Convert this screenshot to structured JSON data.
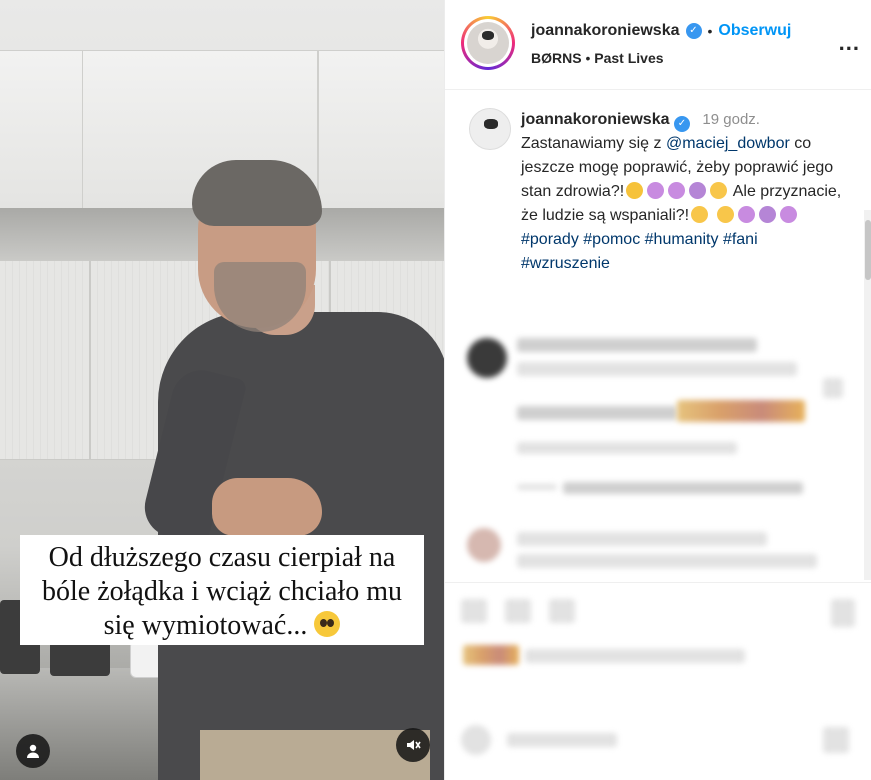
{
  "media": {
    "caption_text": "Od dłuższego czasu cierpiał na bóle żołądka i wciąż chciało mu się wymiotować...",
    "caption_emoji": "pleading-face-emoji",
    "buttons": {
      "profile_tag_icon": "person-icon",
      "mute_icon": "speaker-muted-icon"
    }
  },
  "header": {
    "username": "joannakoroniewska",
    "verified": true,
    "separator": "•",
    "follow_label": "Obserwuj",
    "music_artist": "BØRNS",
    "music_separator": "•",
    "music_track": "Past Lives",
    "more_label": "..."
  },
  "caption": {
    "username": "joannakoroniewska",
    "time": "19 godz.",
    "text_1": "Zastanawiamy się z",
    "mention": "@maciej_dowbor",
    "text_2": "co jeszcze mogę poprawić, żeby poprawić jego stan zdrowia?!",
    "text_3": "Ale przyznacie, że ludzie są wspaniali?!",
    "hashtags": [
      "#porady",
      "#pomoc",
      "#humanity",
      "#fani",
      "#wzruszenie"
    ]
  },
  "colors": {
    "accent": "#0095f6",
    "link": "#00376b",
    "verified": "#3897f0",
    "muted": "#8e8e8e"
  }
}
